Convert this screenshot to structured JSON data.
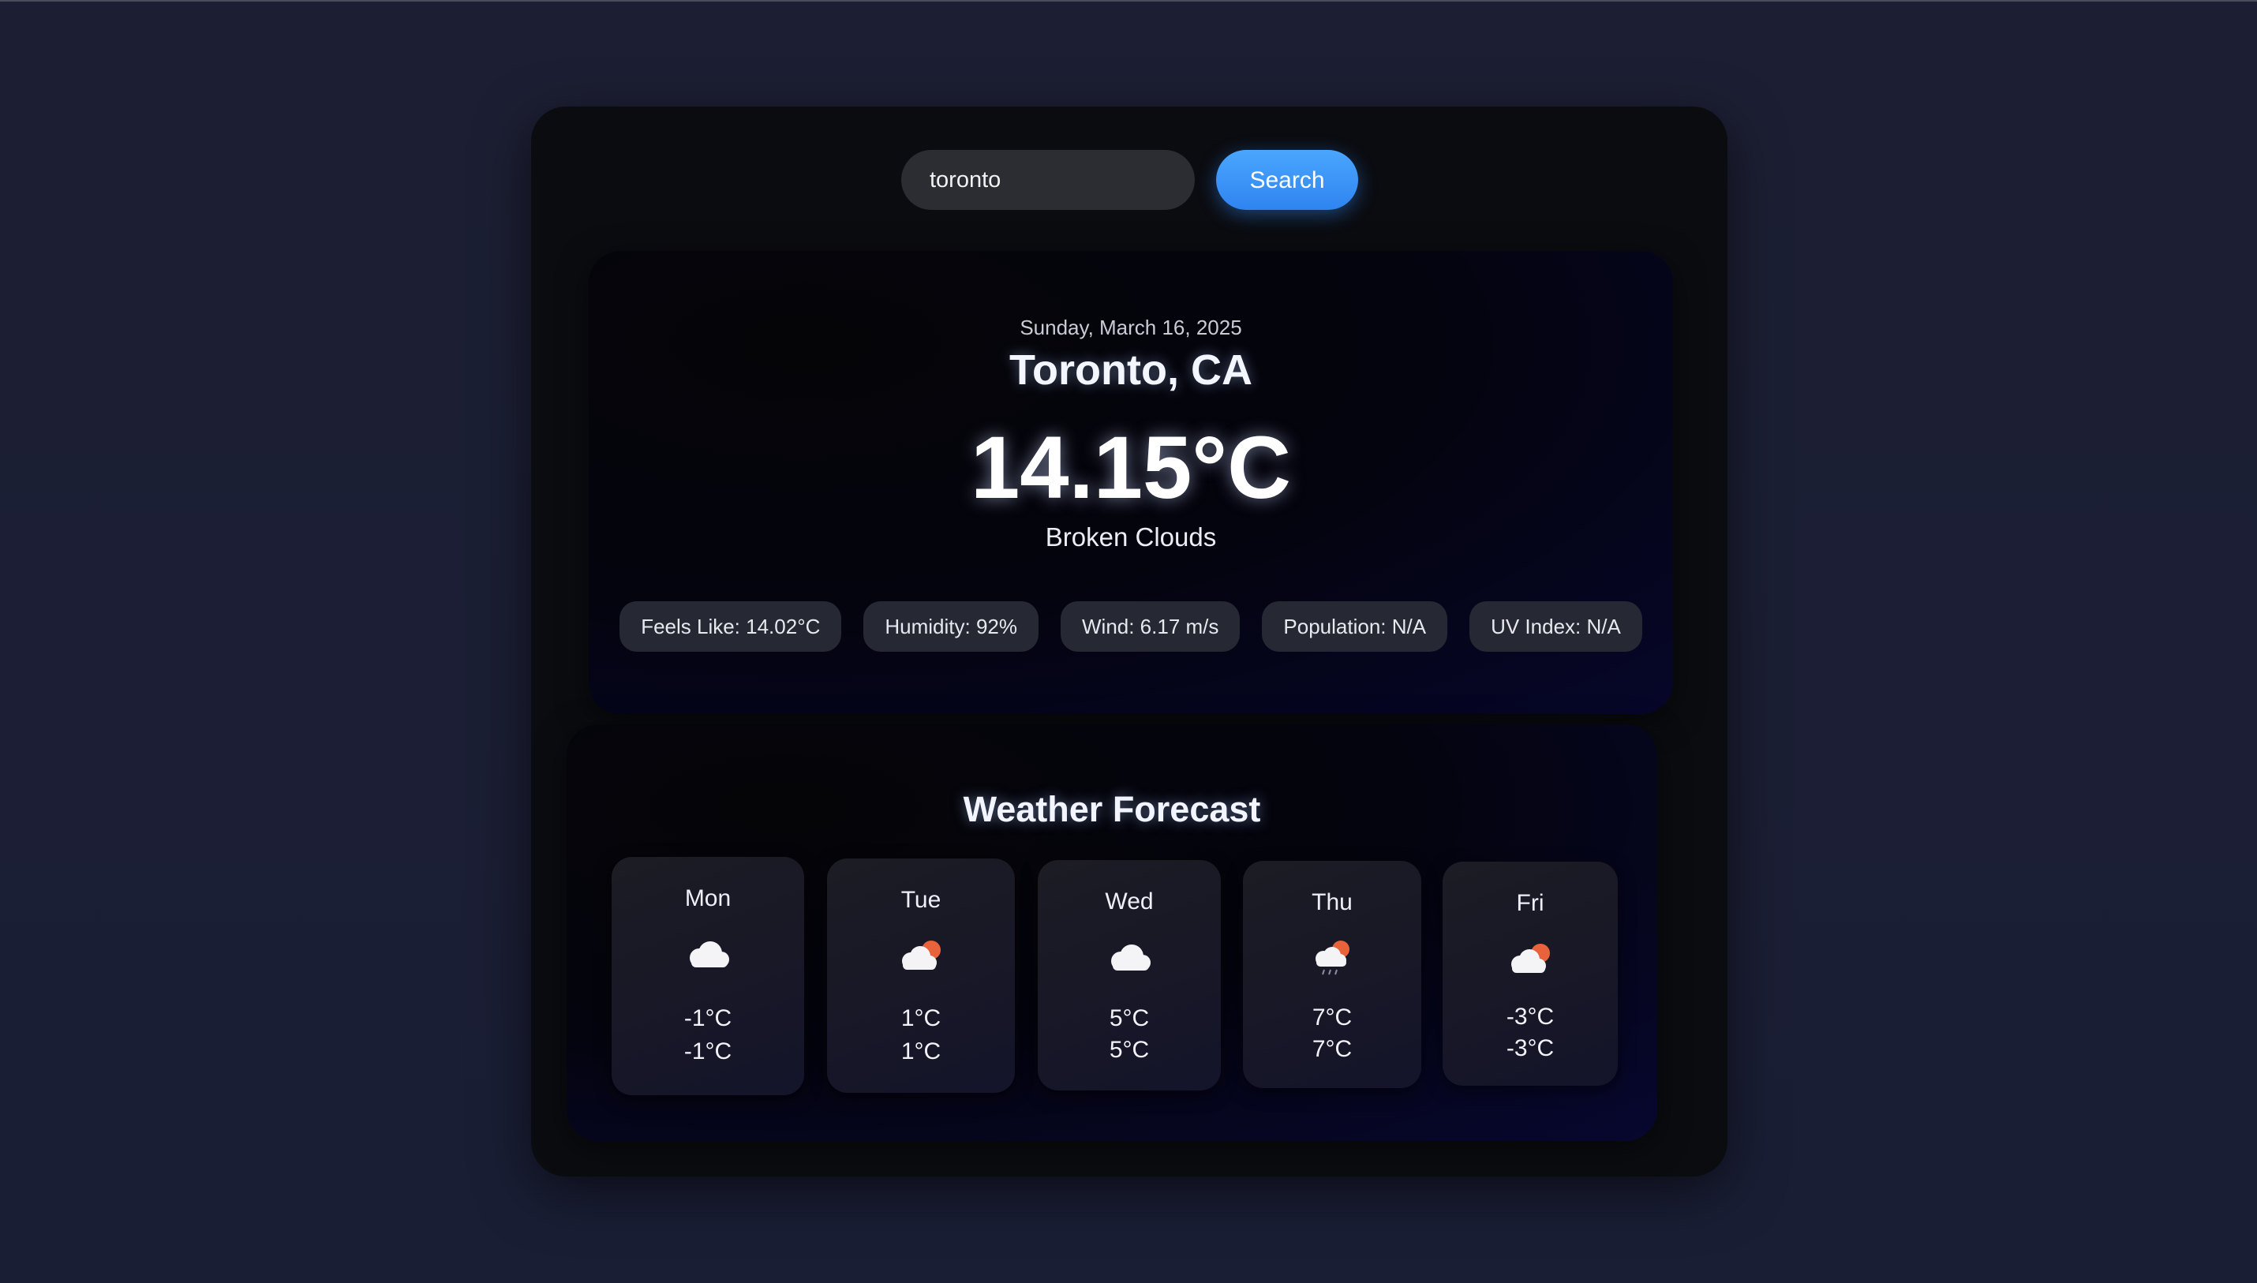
{
  "search": {
    "value": "toronto",
    "placeholder": "",
    "button_label": "Search"
  },
  "current": {
    "date": "Sunday, March 16, 2025",
    "city": "Toronto, CA",
    "temperature": "14.15°C",
    "description": "Broken Clouds",
    "stats": [
      "Feels Like: 14.02°C",
      "Humidity: 92%",
      "Wind: 6.17 m/s",
      "Population: N/A",
      "UV Index: N/A"
    ]
  },
  "forecast": {
    "title": "Weather Forecast",
    "days": [
      {
        "day": "Mon",
        "icon": "cloud-icon",
        "temp_1": "-1°C",
        "temp_2": "-1°C"
      },
      {
        "day": "Tue",
        "icon": "cloud-sun-icon",
        "temp_1": "1°C",
        "temp_2": "1°C"
      },
      {
        "day": "Wed",
        "icon": "cloud-icon",
        "temp_1": "5°C",
        "temp_2": "5°C"
      },
      {
        "day": "Thu",
        "icon": "cloud-sun-rain-icon",
        "temp_1": "7°C",
        "temp_2": "7°C"
      },
      {
        "day": "Fri",
        "icon": "cloud-sun-icon",
        "temp_1": "-3°C",
        "temp_2": "-3°C"
      }
    ]
  },
  "colors": {
    "accent": "#3d96fb",
    "app_background": "#0b0c10",
    "page_background": "#1c1f33",
    "sun": "#e8623c"
  }
}
